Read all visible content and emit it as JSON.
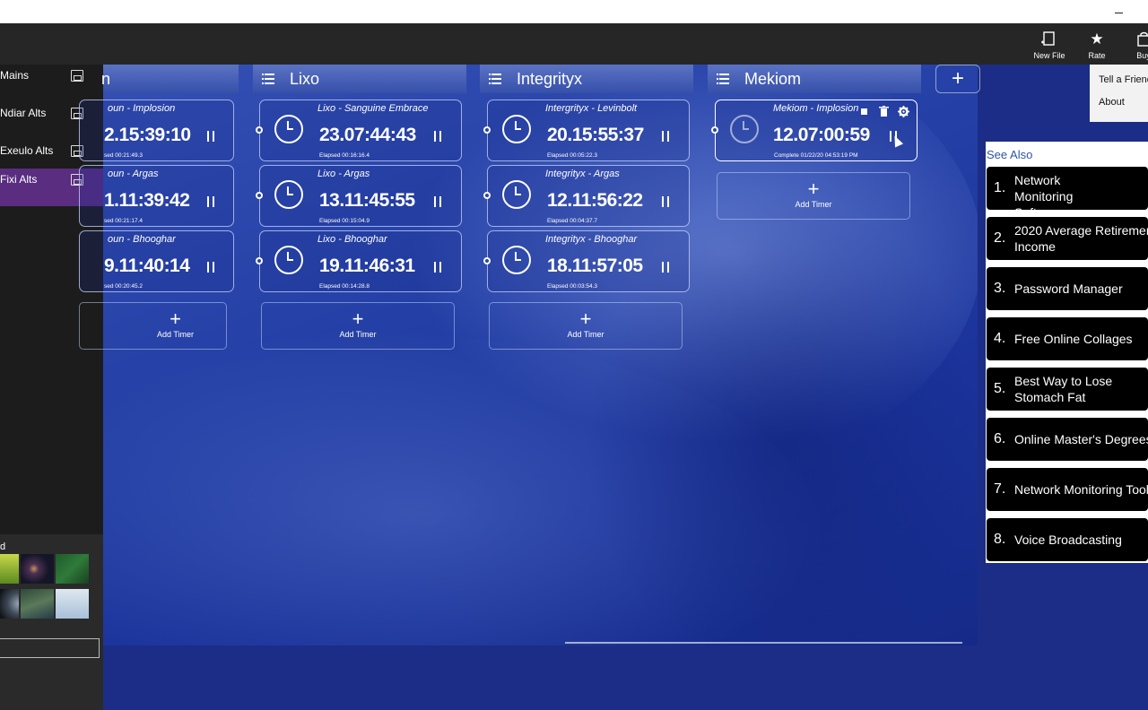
{
  "commandbar": {
    "new_file": "New File",
    "rate": "Rate",
    "buy": "Buy"
  },
  "sidebar": {
    "items": [
      {
        "label": "Mains"
      },
      {
        "label": "Ndiar Alts"
      },
      {
        "label": "Exeulo Alts"
      },
      {
        "label": "Fixi Alts"
      }
    ],
    "bottom_label": "d"
  },
  "columns": [
    {
      "name": "n",
      "timers": [
        {
          "title": "oun - Implosion",
          "time": "2.15:39:10",
          "elapsed": "sed  00:21:49.3"
        },
        {
          "title": "oun - Argas",
          "time": "1.11:39:42",
          "elapsed": "sed  00:21:17.4"
        },
        {
          "title": "oun - Bhooghar",
          "time": "9.11:40:14",
          "elapsed": "sed  00:20:45.2"
        }
      ],
      "add_label": "Add Timer"
    },
    {
      "name": "Lixo",
      "timers": [
        {
          "title": "Lixo - Sanguine Embrace",
          "time": "23.07:44:43",
          "elapsed": "Elapsed  00:16:16.4"
        },
        {
          "title": "Lixo - Argas",
          "time": "13.11:45:55",
          "elapsed": "Elapsed  00:15:04.9"
        },
        {
          "title": "Lixo - Bhooghar",
          "time": "19.11:46:31",
          "elapsed": "Elapsed  00:14:28.8"
        }
      ],
      "add_label": "Add Timer"
    },
    {
      "name": "Integrityx",
      "timers": [
        {
          "title": "Intergrityx - Levinbolt",
          "time": "20.15:55:37",
          "elapsed": "Elapsed  00:05:22.3"
        },
        {
          "title": "Integrityx - Argas",
          "time": "12.11:56:22",
          "elapsed": "Elapsed  00:04:37.7"
        },
        {
          "title": "Integrityx - Bhooghar",
          "time": "18.11:57:05",
          "elapsed": "Elapsed  00:03:54.3"
        }
      ],
      "add_label": "Add Timer"
    },
    {
      "name": "Mekiom",
      "timers": [
        {
          "title": "Mekiom - Implosion",
          "time": "12.07:00:59",
          "elapsed": "Complete  01/22/20 04:53:19 PM"
        }
      ],
      "add_label": "Add Timer"
    }
  ],
  "flyout": {
    "items": [
      "Tell a Friend",
      "About"
    ]
  },
  "see_also": {
    "header": "See Also",
    "items": [
      {
        "num": "1.",
        "text": "Network Monitoring Software"
      },
      {
        "num": "2.",
        "text": "2020 Average Retirement Income"
      },
      {
        "num": "3.",
        "text": "Password Manager"
      },
      {
        "num": "4.",
        "text": "Free Online Collages"
      },
      {
        "num": "5.",
        "text": "Best Way to Lose Stomach Fat"
      },
      {
        "num": "6.",
        "text": "Online Master's Degrees"
      },
      {
        "num": "7.",
        "text": "Network Monitoring Tools"
      },
      {
        "num": "8.",
        "text": "Voice Broadcasting"
      }
    ]
  },
  "colors": {
    "accent_purple": "#5a2d80",
    "background_blue": "#1b2d86",
    "column_header": "#4a63b8",
    "ad_link": "#2c54a8"
  }
}
